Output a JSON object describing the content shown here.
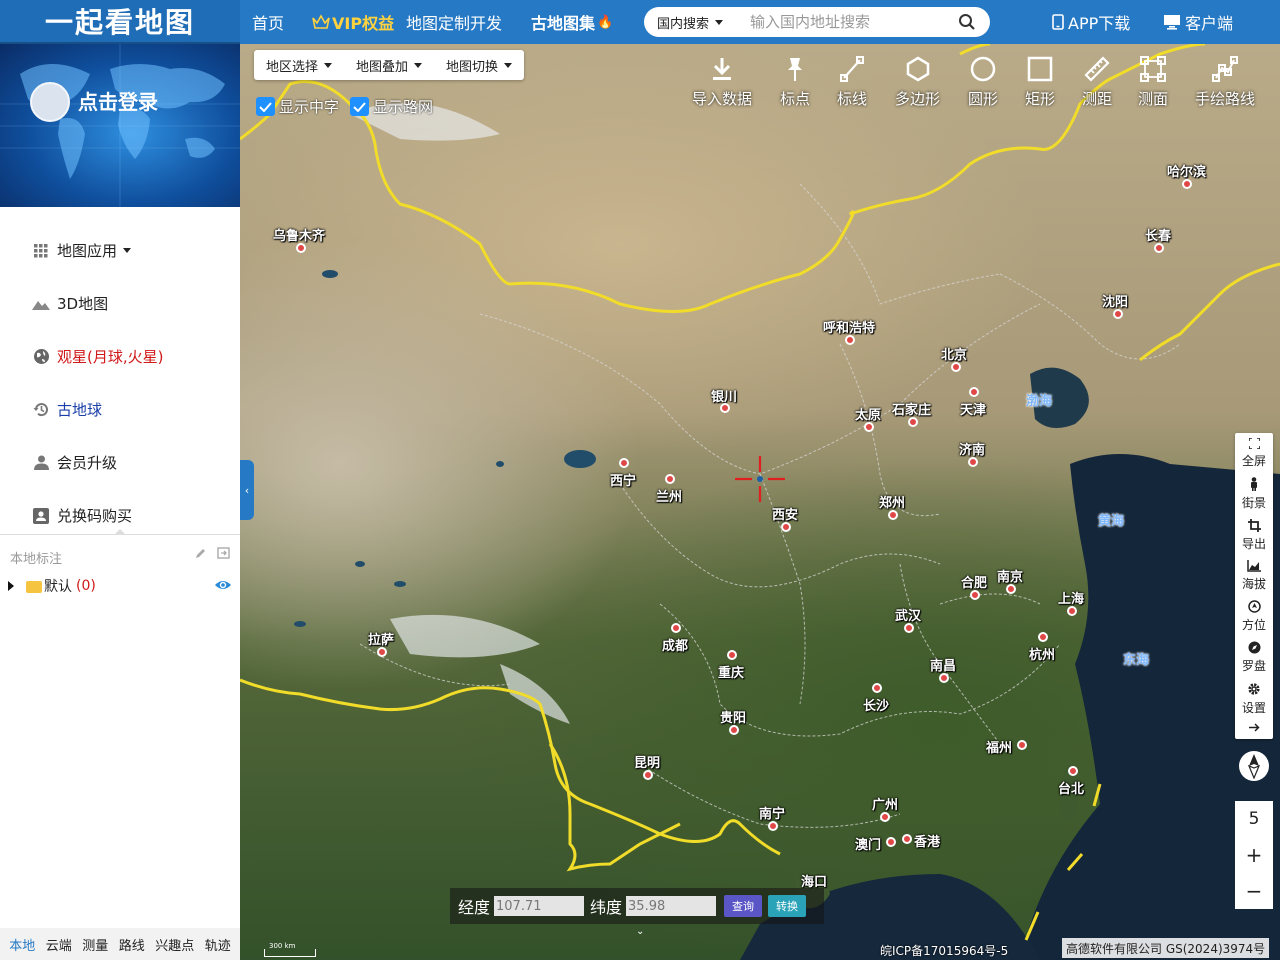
{
  "header": {
    "logo": "一起看地图",
    "nav": {
      "home": "首页",
      "vip": "VIP权益",
      "custom": "地图定制开发",
      "atlas": "古地图集",
      "app": "APP下载",
      "client": "客户端"
    },
    "search": {
      "scope": "国内搜索",
      "placeholder": "输入国内地址搜索"
    }
  },
  "sidebar": {
    "login": "点击登录",
    "menu": [
      {
        "label": "地图应用"
      },
      {
        "label": "3D地图"
      },
      {
        "label": "观星(月球,火星)"
      },
      {
        "label": "古地球"
      },
      {
        "label": "会员升级"
      },
      {
        "label": "兑换码购买"
      }
    ],
    "local": {
      "title": "本地标注",
      "folder": "默认",
      "count": "(0)"
    },
    "tabs": [
      "本地",
      "云端",
      "测量",
      "路线",
      "兴趣点",
      "轨迹"
    ]
  },
  "map": {
    "dropdowns": [
      "地区选择",
      "地图叠加",
      "地图切换"
    ],
    "checks": [
      "显示中字",
      "显示路网"
    ],
    "tools": [
      "导入数据",
      "标点",
      "标线",
      "多边形",
      "圆形",
      "矩形",
      "测距",
      "测面",
      "手绘路线"
    ],
    "cities": [
      "乌鲁木齐",
      "哈尔滨",
      "长春",
      "沈阳",
      "呼和浩特",
      "北京",
      "天津",
      "银川",
      "太原",
      "石家庄",
      "济南",
      "西宁",
      "兰州",
      "西安",
      "郑州",
      "合肥",
      "南京",
      "上海",
      "武汉",
      "杭州",
      "成都",
      "重庆",
      "拉萨",
      "南昌",
      "长沙",
      "贵阳",
      "福州",
      "昆明",
      "台北",
      "广州",
      "南宁",
      "澳门",
      "香港",
      "海口"
    ],
    "seas": [
      "渤海",
      "黄海",
      "东海"
    ],
    "right_panel": [
      "全屏",
      "街景",
      "导出",
      "海拔",
      "方位",
      "罗盘",
      "设置"
    ],
    "zoom": {
      "level": "5",
      "in": "+",
      "out": "−"
    },
    "coord": {
      "lng_label": "经度",
      "lng_value": "107.71",
      "lat_label": "纬度",
      "lat_value": "35.98",
      "query": "查询",
      "convert": "转换"
    },
    "icp": "皖ICP备17015964号-5",
    "copyright": "高德软件有限公司 GS(2024)3974号",
    "scale": "300 km"
  }
}
